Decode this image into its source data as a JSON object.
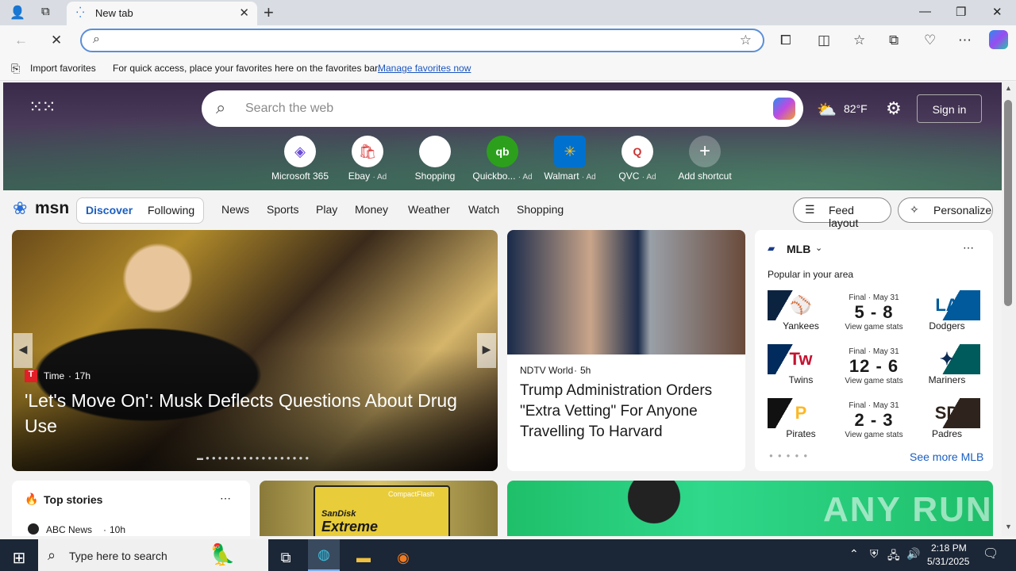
{
  "browser": {
    "tab_title": "New tab",
    "address_placeholder": "",
    "favorites_bar": {
      "import_label": "Import favorites",
      "hint": "For quick access, place your favorites here on the favorites bar.",
      "manage_link": "Manage favorites now"
    }
  },
  "hero": {
    "search_placeholder": "Search the web",
    "weather_temp": "82°F",
    "sign_in": "Sign in",
    "shortcuts": [
      {
        "label": "Microsoft 365",
        "ad": ""
      },
      {
        "label": "Ebay",
        "ad": "· Ad"
      },
      {
        "label": "Shopping",
        "ad": ""
      },
      {
        "label": "Quickbo...",
        "ad": "· Ad"
      },
      {
        "label": "Walmart",
        "ad": "· Ad"
      },
      {
        "label": "QVC",
        "ad": "· Ad"
      },
      {
        "label": "Add shortcut",
        "ad": ""
      }
    ]
  },
  "msn": {
    "logo": "msn",
    "tabs": [
      "Discover",
      "Following"
    ],
    "nav": [
      "News",
      "Sports",
      "Play",
      "Money",
      "Weather",
      "Watch",
      "Shopping"
    ],
    "feed_layout": "Feed layout",
    "personalize": "Personalize"
  },
  "main_story": {
    "source": "Time",
    "age": "17h",
    "headline": "'Let's Move On': Musk Deflects Questions About Drug Use"
  },
  "side_story": {
    "source": "NDTV World",
    "age": "5h",
    "headline": "Trump Administration Orders \"Extra Vetting\" For Anyone Travelling To Harvard"
  },
  "mlb": {
    "title": "MLB",
    "subtitle": "Popular in your area",
    "see_more": "See more MLB",
    "games": [
      {
        "status": "Final · May 31",
        "home": "Yankees",
        "away": "Dodgers",
        "score": "5 - 8",
        "stats": "View game stats"
      },
      {
        "status": "Final · May 31",
        "home": "Twins",
        "away": "Mariners",
        "score": "12 - 6",
        "stats": "View game stats"
      },
      {
        "status": "Final · May 31",
        "home": "Pirates",
        "away": "Padres",
        "score": "2 - 3",
        "stats": "View game stats"
      }
    ]
  },
  "top_stories": {
    "title": "Top stories",
    "first_source": "ABC News",
    "first_age": "10h"
  },
  "ad_card": {
    "brand": "CompactFlash",
    "product_line1": "SanDisk",
    "product_line2": "Extreme"
  },
  "watermark": "ANY RUN",
  "taskbar": {
    "search_placeholder": "Type here to search",
    "time": "2:18 PM",
    "date": "5/31/2025"
  }
}
